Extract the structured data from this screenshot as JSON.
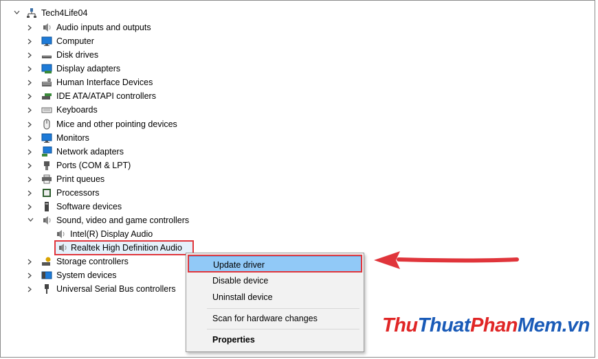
{
  "tree": {
    "root": {
      "label": "Tech4Life04"
    },
    "items": [
      {
        "label": "Audio inputs and outputs",
        "icon": "speaker-icon"
      },
      {
        "label": "Computer",
        "icon": "monitor-icon"
      },
      {
        "label": "Disk drives",
        "icon": "disk-drive-icon"
      },
      {
        "label": "Display adapters",
        "icon": "display-adapter-icon"
      },
      {
        "label": "Human Interface Devices",
        "icon": "hid-icon"
      },
      {
        "label": "IDE ATA/ATAPI controllers",
        "icon": "ide-controller-icon"
      },
      {
        "label": "Keyboards",
        "icon": "keyboard-icon"
      },
      {
        "label": "Mice and other pointing devices",
        "icon": "mouse-icon"
      },
      {
        "label": "Monitors",
        "icon": "monitor-icon"
      },
      {
        "label": "Network adapters",
        "icon": "network-icon"
      },
      {
        "label": "Ports (COM & LPT)",
        "icon": "port-icon"
      },
      {
        "label": "Print queues",
        "icon": "printer-icon"
      },
      {
        "label": "Processors",
        "icon": "processor-icon"
      },
      {
        "label": "Software devices",
        "icon": "software-device-icon"
      },
      {
        "label": "Sound, video and game controllers",
        "icon": "speaker-icon"
      },
      {
        "label": "Intel(R) Display Audio",
        "icon": "speaker-icon"
      },
      {
        "label": "Realtek High Definition Audio",
        "icon": "speaker-icon"
      },
      {
        "label": "Storage controllers",
        "icon": "storage-icon"
      },
      {
        "label": "System devices",
        "icon": "system-device-icon"
      },
      {
        "label": "Universal Serial Bus controllers",
        "icon": "usb-icon"
      }
    ]
  },
  "context_menu": {
    "items": [
      {
        "label": "Update driver"
      },
      {
        "label": "Disable device"
      },
      {
        "label": "Uninstall device"
      },
      {
        "label": "Scan for hardware changes"
      },
      {
        "label": "Properties"
      }
    ]
  },
  "watermark": {
    "part1": "Thu",
    "part2": "Thuat",
    "part3": "Phan",
    "part4": "Mem.vn"
  },
  "colors": {
    "highlight": "#91c9f7",
    "annotation_red": "#e0353b",
    "selection": "#e5f1fb"
  }
}
